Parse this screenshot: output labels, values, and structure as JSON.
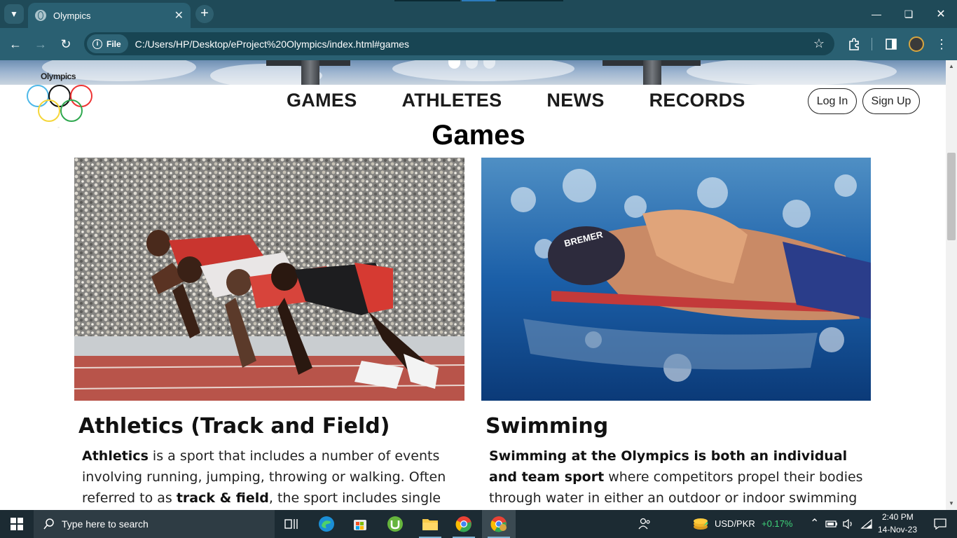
{
  "browser": {
    "tab_title": "Olympics",
    "url_chip": "File",
    "url": "C:/Users/HP/Desktop/eProject%20Olympics/index.html#games"
  },
  "site": {
    "logo_text": "Olympics",
    "nav": [
      "GAMES",
      "ATHLETES",
      "NEWS",
      "RECORDS"
    ],
    "login_label": "Log In",
    "signup_label": "Sign Up",
    "section_title": "Games",
    "carousel_dots": 3,
    "carousel_active": 0
  },
  "cards": [
    {
      "image_label": "Sprinters in starting blocks",
      "title": "Athletics (Track and Field)",
      "text_parts": [
        {
          "b": "Athletics"
        },
        {
          "t": " is a sport that includes a number of events involving running, jumping, throwing or walking. Often referred to as "
        },
        {
          "b": "track & field"
        },
        {
          "t": ", the sport includes single"
        }
      ]
    },
    {
      "image_label": "Swimmer with BREMER cap underwater",
      "cap_text": "BREMER",
      "title": "Swimming",
      "text_parts": [
        {
          "b": "Swimming at the Olympics is both an individual and team sport"
        },
        {
          "t": " where competitors propel their bodies through water in either an outdoor or indoor swimming pool using"
        }
      ]
    }
  ],
  "taskbar": {
    "search_placeholder": "Type here to search",
    "currency_pair": "USD/PKR",
    "currency_change": "+0.17%",
    "time": "2:40 PM",
    "date": "14-Nov-23"
  },
  "colors": {
    "chrome_dark": "#1f4a58",
    "chrome_toolbar": "#2a6072",
    "currency_up": "#3fd47a"
  }
}
